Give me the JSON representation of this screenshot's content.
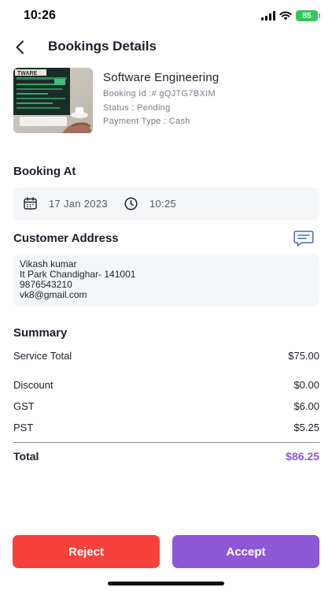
{
  "status_bar": {
    "time": "10:26",
    "battery": "85"
  },
  "header": {
    "title": "Bookings Details",
    "back_icon": "chevron-left-icon"
  },
  "service": {
    "name": "Software Engineering",
    "booking_id": "Booking Id :# gQJTG7BXIM",
    "status": "Status : Pending",
    "payment_type": "Payment Type : Cash",
    "image_text": "TWARE"
  },
  "booking_at": {
    "title": "Booking At",
    "date": "17 Jan 2023",
    "time": "10:25",
    "date_icon": "calendar-icon",
    "time_icon": "clock-icon"
  },
  "customer": {
    "title": "Customer Address",
    "chat_icon": "chat-icon",
    "name": "Vikash kumar",
    "address": "It Park Chandighar- 141001",
    "phone": "9876543210",
    "email": "vk8@gmail.com"
  },
  "summary": {
    "title": "Summary",
    "rows": [
      {
        "label": "Service Total",
        "value": "$75.00"
      },
      {
        "label": "Discount",
        "value": "$0.00"
      },
      {
        "label": "GST",
        "value": "$6.00"
      },
      {
        "label": "PST",
        "value": "$5.25"
      }
    ],
    "total_label": "Total",
    "total_value": "$86.25"
  },
  "actions": {
    "reject": "Reject",
    "accept": "Accept"
  },
  "colors": {
    "accent": "#8d58d6",
    "reject": "#f6423a",
    "panel": "#f5f6f7",
    "battery": "#34c759"
  }
}
